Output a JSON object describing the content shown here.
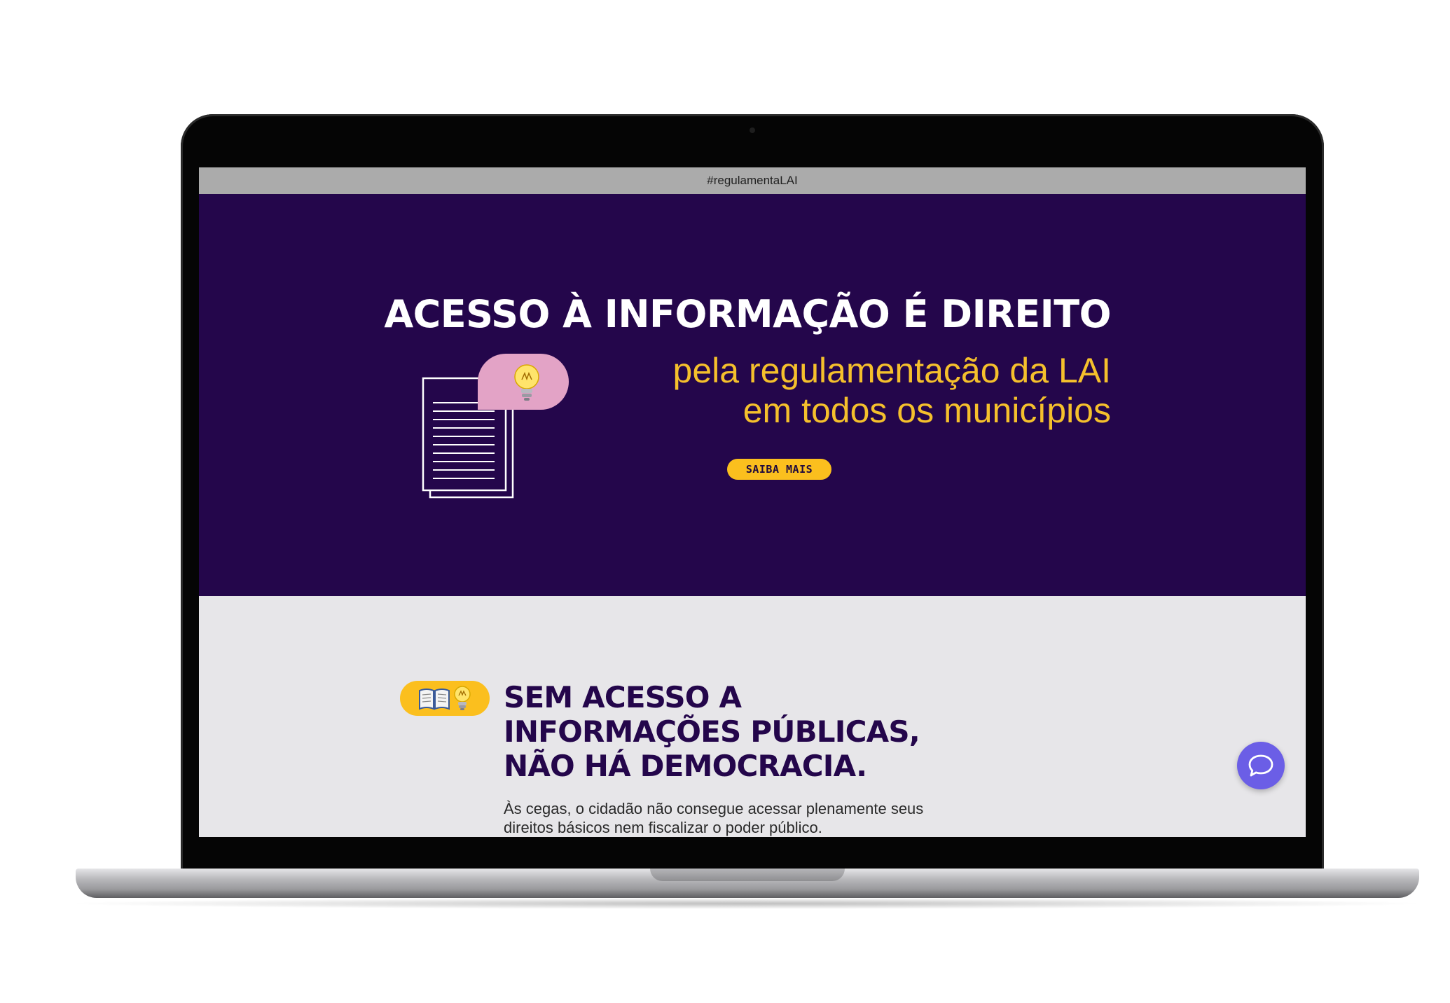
{
  "browser": {
    "tab_title": "#regulamentaLAI"
  },
  "hero": {
    "title": "ACESSO À INFORMAÇÃO É DIREITO",
    "subtitle_line1": "pela regulamentação da LAI",
    "subtitle_line2": "em todos os municípios",
    "cta_label": "SAIBA MAIS",
    "illustration_icons": [
      "documents-icon",
      "lightbulb-icon"
    ]
  },
  "section": {
    "badge_icons": [
      "book-icon",
      "lightbulb-icon"
    ],
    "title_line1": "SEM ACESSO A",
    "title_line2": "INFORMAÇÕES PÚBLICAS,",
    "title_line3": "NÃO HÁ DEMOCRACIA.",
    "text": "Às cegas, o cidadão não consegue acessar plenamente seus direitos básicos nem fiscalizar o poder público."
  },
  "chat": {
    "icon": "chat-bubble-icon"
  },
  "colors": {
    "hero_bg": "#24064b",
    "accent_yellow": "#fbbf1e",
    "subtitle_yellow": "#f5c02c",
    "bubble_pink": "#e3a3c6",
    "content_bg": "#e7e6e9",
    "chat_purple": "#6b5ee6"
  }
}
